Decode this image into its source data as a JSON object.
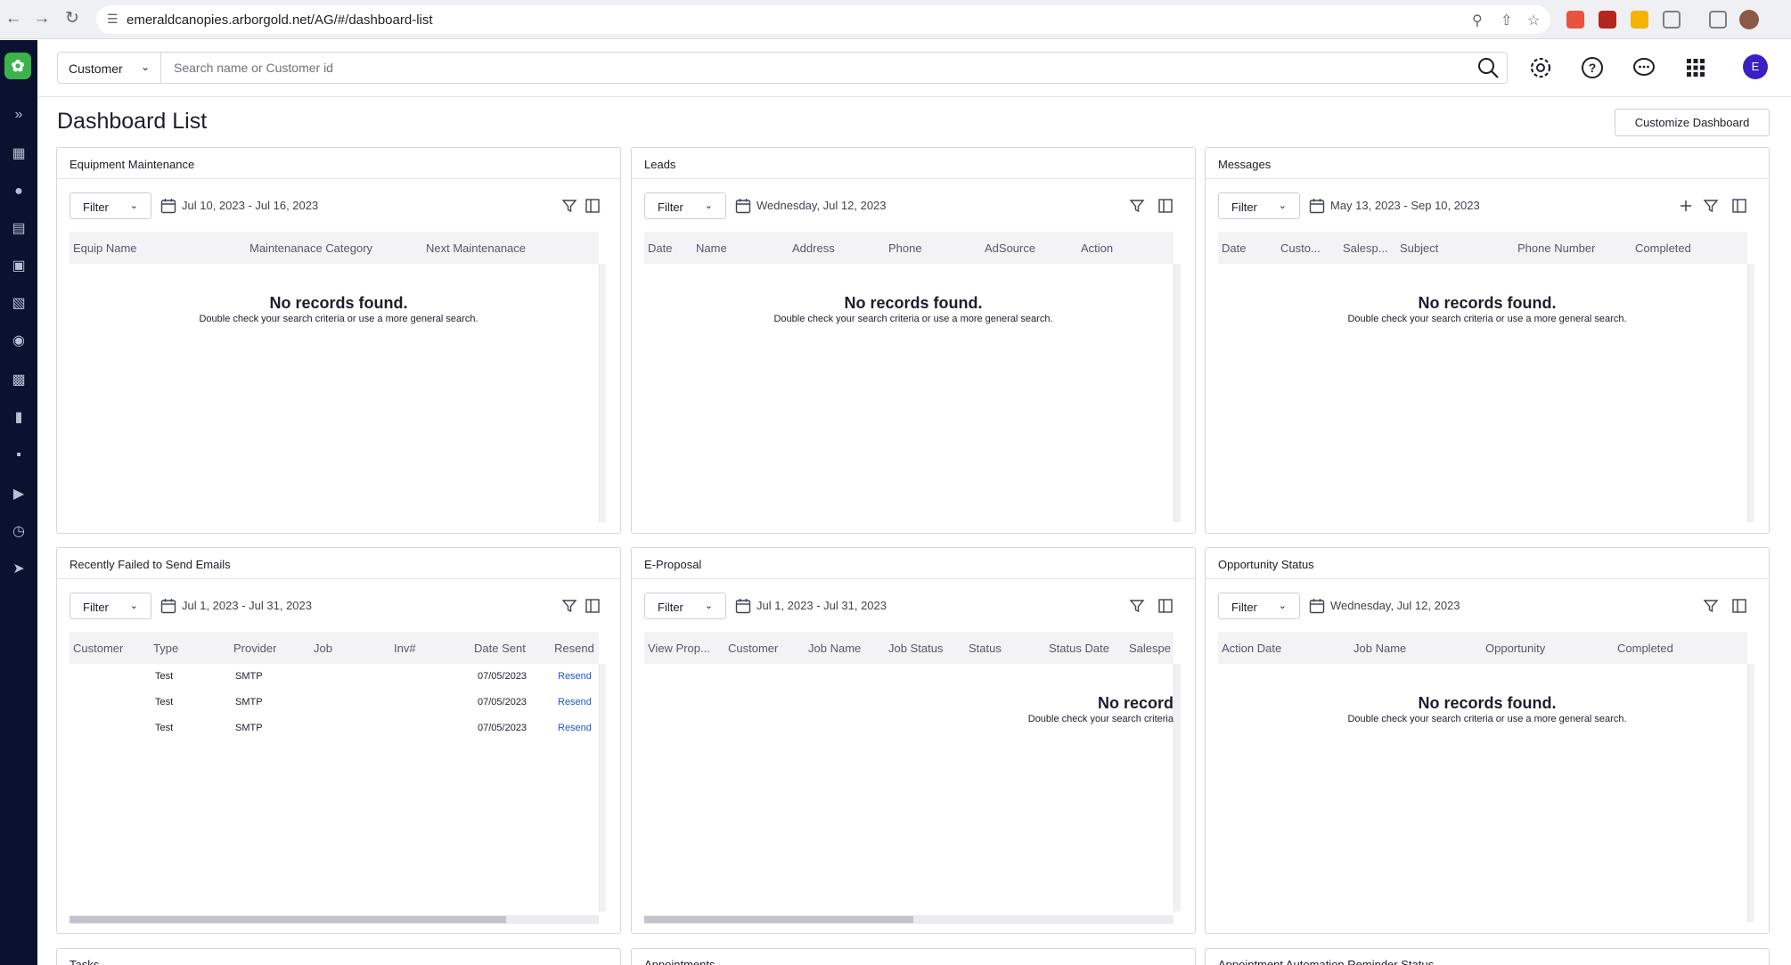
{
  "browser": {
    "url": "emeraldcanopies.arborgold.net/AG/#/dashboard-list"
  },
  "search": {
    "type_label": "Customer",
    "placeholder": "Search name or Customer id"
  },
  "user": {
    "avatar_initial": "E"
  },
  "page": {
    "title": "Dashboard List",
    "customize_label": "Customize Dashboard"
  },
  "common": {
    "filter_label": "Filter",
    "empty_title": "No records found.",
    "empty_sub": "Double check your search criteria or use a more general search."
  },
  "widgets": [
    {
      "title": "Equipment Maintenance",
      "date_range": "Jul 10, 2023 - Jul 16, 2023",
      "columns": [
        "Equip Name",
        "Maintenanace Category",
        "Next Maintenanace"
      ],
      "empty": true
    },
    {
      "title": "Leads",
      "date_range": "Wednesday, Jul 12, 2023",
      "columns": [
        "Date",
        "Name",
        "Address",
        "Phone",
        "AdSource",
        "Action"
      ],
      "empty": true
    },
    {
      "title": "Messages",
      "date_range": "May 13, 2023 - Sep 10, 2023",
      "columns": [
        "Date",
        "Custo...",
        "Salesp...",
        "Subject",
        "Phone Number",
        "Completed"
      ],
      "empty": true
    },
    {
      "title": "Recently Failed to Send Emails",
      "date_range": "Jul 1, 2023 - Jul 31, 2023",
      "columns": [
        "Customer",
        "Type",
        "Provider",
        "Job",
        "Inv#",
        "Date Sent",
        "Resend"
      ],
      "rows": [
        {
          "type": "Test",
          "provider": "SMTP",
          "date_sent": "07/05/2023",
          "resend": "Resend"
        },
        {
          "type": "Test",
          "provider": "SMTP",
          "date_sent": "07/05/2023",
          "resend": "Resend"
        },
        {
          "type": "Test",
          "provider": "SMTP",
          "date_sent": "07/05/2023",
          "resend": "Resend"
        }
      ]
    },
    {
      "title": "E-Proposal",
      "date_range": "Jul 1, 2023 - Jul 31, 2023",
      "columns": [
        "View Prop...",
        "Customer",
        "Job Name",
        "Job Status",
        "Status",
        "Status Date",
        "Salespe"
      ],
      "empty_title_partial": "No record",
      "empty_sub_partial": "Double check your search criteria"
    },
    {
      "title": "Opportunity Status",
      "date_range": "Wednesday, Jul 12, 2023",
      "columns": [
        "Action Date",
        "Job Name",
        "Opportunity",
        "Completed"
      ],
      "empty": true
    }
  ],
  "stub_titles": [
    "Tasks",
    "Appointments",
    "Appointment Automation Reminder Status"
  ]
}
